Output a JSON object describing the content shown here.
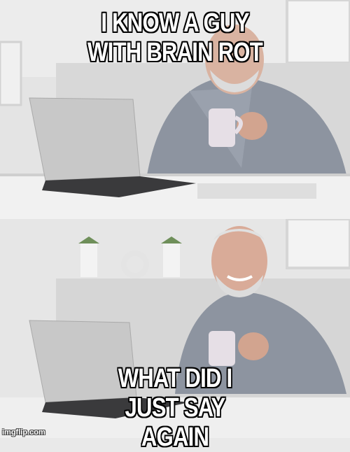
{
  "meme": {
    "template": "Hide the Pain Harold",
    "top_text": "I KNOW A GUY WITH BRAIN ROT",
    "bottom_text": "WHAT DID I JUST SAY AGAIN",
    "watermark": "imgflip.com"
  }
}
